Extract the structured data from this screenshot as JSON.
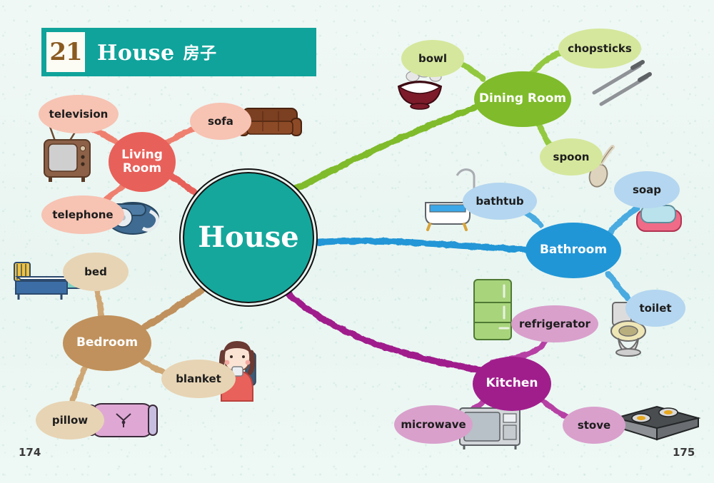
{
  "header": {
    "unit_number": "21",
    "title_en": "House",
    "title_cn": "房子",
    "bar_color": "#10a39b",
    "number_color": "#8a5a20"
  },
  "center": {
    "label": "House",
    "color": "#16a79c"
  },
  "page_numbers": {
    "left": "174",
    "right": "175"
  },
  "chart_data": {
    "type": "diagram",
    "title": "House mind map",
    "center": "House",
    "branches": [
      {
        "name": "Living Room",
        "hub_color": "#e8605a",
        "leaf_color": "#f7c3b3",
        "leaves": [
          {
            "label": "television",
            "icon": "television-icon"
          },
          {
            "label": "sofa",
            "icon": "sofa-icon"
          },
          {
            "label": "telephone",
            "icon": "telephone-icon"
          }
        ]
      },
      {
        "name": "Dining Room",
        "hub_color": "#7fbb2b",
        "leaf_color": "#d5e79c",
        "leaves": [
          {
            "label": "bowl",
            "icon": "rice-bowl-icon"
          },
          {
            "label": "chopsticks",
            "icon": "chopsticks-icon"
          },
          {
            "label": "spoon",
            "icon": "spoon-icon"
          }
        ]
      },
      {
        "name": "Bathroom",
        "hub_color": "#2196d6",
        "leaf_color": "#b4d6f0",
        "leaves": [
          {
            "label": "bathtub",
            "icon": "bathtub-icon"
          },
          {
            "label": "soap",
            "icon": "soap-icon"
          },
          {
            "label": "toilet",
            "icon": "toilet-icon"
          }
        ]
      },
      {
        "name": "Kitchen",
        "hub_color": "#a01e8c",
        "leaf_color": "#d9a0cc",
        "leaves": [
          {
            "label": "refrigerator",
            "icon": "refrigerator-icon"
          },
          {
            "label": "microwave",
            "icon": "microwave-icon"
          },
          {
            "label": "stove",
            "icon": "stove-icon"
          }
        ]
      },
      {
        "name": "Bedroom",
        "hub_color": "#c0915c",
        "leaf_color": "#e7d4b4",
        "leaves": [
          {
            "label": "bed",
            "icon": "bed-icon"
          },
          {
            "label": "blanket",
            "icon": "girl-with-blanket-icon"
          },
          {
            "label": "pillow",
            "icon": "pillow-icon"
          }
        ]
      }
    ]
  },
  "nodes": {
    "living_room": {
      "label": "Living\nRoom"
    },
    "dining_room": {
      "label": "Dining Room"
    },
    "bathroom": {
      "label": "Bathroom"
    },
    "kitchen": {
      "label": "Kitchen"
    },
    "bedroom": {
      "label": "Bedroom"
    },
    "television": {
      "label": "television"
    },
    "sofa": {
      "label": "sofa"
    },
    "telephone": {
      "label": "telephone"
    },
    "bowl": {
      "label": "bowl"
    },
    "chopsticks": {
      "label": "chopsticks"
    },
    "spoon": {
      "label": "spoon"
    },
    "bathtub": {
      "label": "bathtub"
    },
    "soap": {
      "label": "soap"
    },
    "toilet": {
      "label": "toilet"
    },
    "refrigerator": {
      "label": "refrigerator"
    },
    "microwave": {
      "label": "microwave"
    },
    "stove": {
      "label": "stove"
    },
    "bed": {
      "label": "bed"
    },
    "blanket": {
      "label": "blanket"
    },
    "pillow": {
      "label": "pillow"
    }
  }
}
